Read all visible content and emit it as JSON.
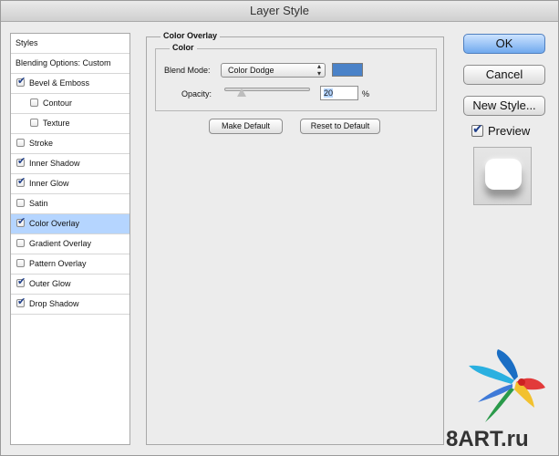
{
  "window": {
    "title": "Layer Style"
  },
  "sidebar": {
    "items": [
      {
        "label": "Styles",
        "checkbox": false,
        "checked": false,
        "indent": 0,
        "selected": false
      },
      {
        "label": "Blending Options: Custom",
        "checkbox": false,
        "checked": false,
        "indent": 0,
        "selected": false
      },
      {
        "label": "Bevel & Emboss",
        "checkbox": true,
        "checked": true,
        "indent": 0,
        "selected": false
      },
      {
        "label": "Contour",
        "checkbox": true,
        "checked": false,
        "indent": 1,
        "selected": false
      },
      {
        "label": "Texture",
        "checkbox": true,
        "checked": false,
        "indent": 1,
        "selected": false
      },
      {
        "label": "Stroke",
        "checkbox": true,
        "checked": false,
        "indent": 0,
        "selected": false
      },
      {
        "label": "Inner Shadow",
        "checkbox": true,
        "checked": true,
        "indent": 0,
        "selected": false
      },
      {
        "label": "Inner Glow",
        "checkbox": true,
        "checked": true,
        "indent": 0,
        "selected": false
      },
      {
        "label": "Satin",
        "checkbox": true,
        "checked": false,
        "indent": 0,
        "selected": false
      },
      {
        "label": "Color Overlay",
        "checkbox": true,
        "checked": true,
        "indent": 0,
        "selected": true
      },
      {
        "label": "Gradient Overlay",
        "checkbox": true,
        "checked": false,
        "indent": 0,
        "selected": false
      },
      {
        "label": "Pattern Overlay",
        "checkbox": true,
        "checked": false,
        "indent": 0,
        "selected": false
      },
      {
        "label": "Outer Glow",
        "checkbox": true,
        "checked": true,
        "indent": 0,
        "selected": false
      },
      {
        "label": "Drop Shadow",
        "checkbox": true,
        "checked": true,
        "indent": 0,
        "selected": false
      }
    ]
  },
  "panel": {
    "title": "Color Overlay",
    "group_title": "Color",
    "blend_mode_label": "Blend Mode:",
    "blend_mode_value": "Color Dodge",
    "overlay_color": "#4a82c8",
    "opacity_label": "Opacity:",
    "opacity_value": "20",
    "opacity_fraction": 0.2,
    "opacity_unit": "%",
    "make_default_label": "Make Default",
    "reset_default_label": "Reset to Default"
  },
  "actions": {
    "ok_label": "OK",
    "cancel_label": "Cancel",
    "new_style_label": "New Style...",
    "preview_label": "Preview",
    "preview_checked": true
  },
  "watermark": {
    "text": "8ART.ru"
  }
}
